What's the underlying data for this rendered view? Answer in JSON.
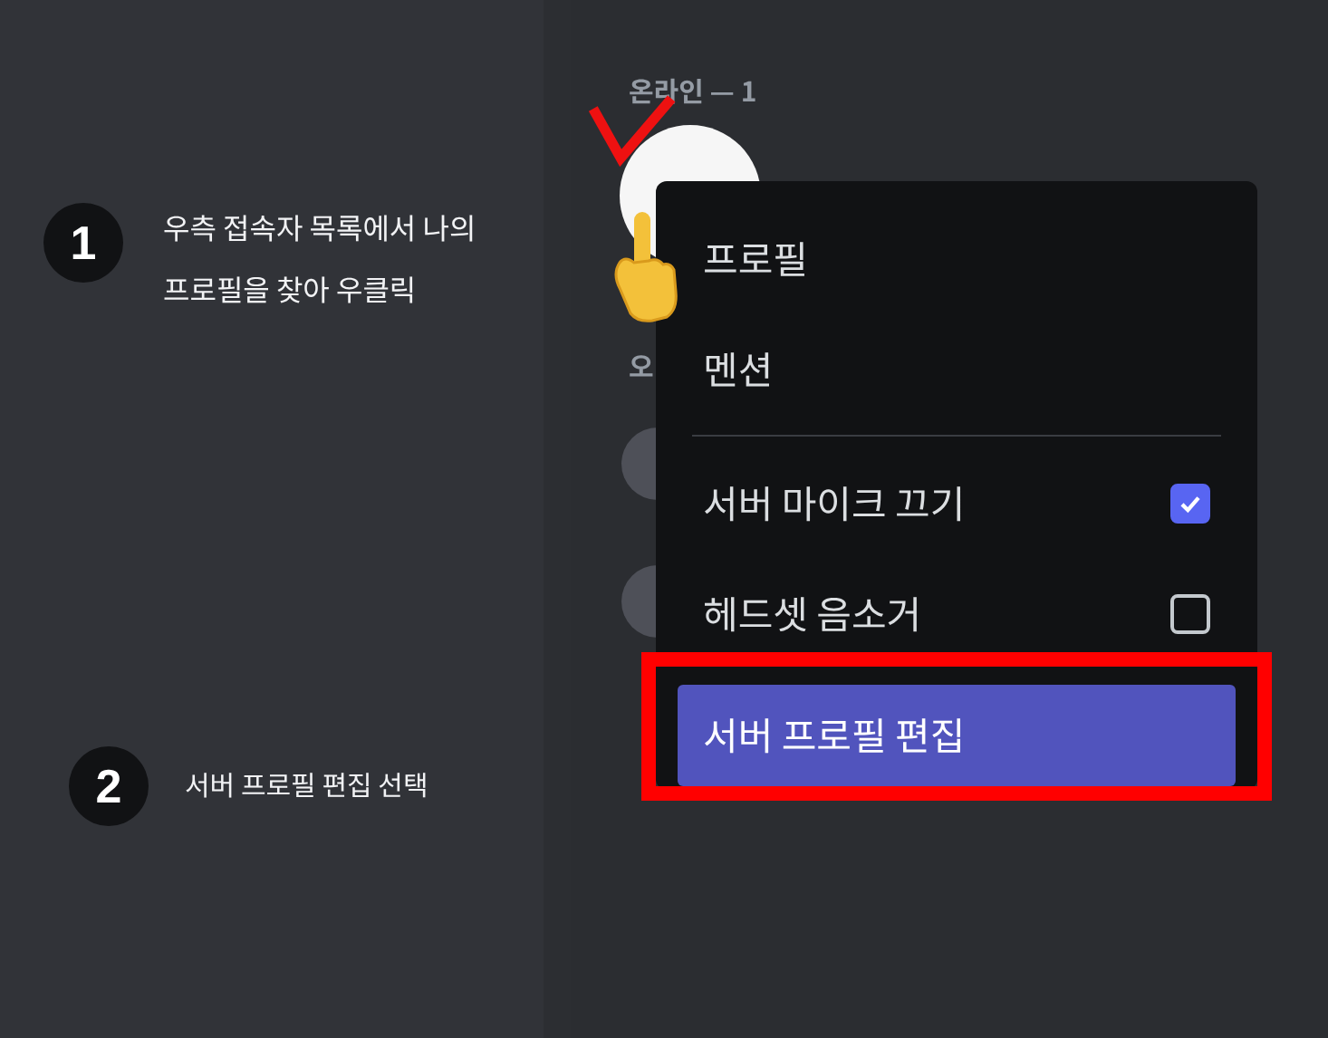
{
  "steps": [
    {
      "number": "1",
      "text": "우측 접속자 목록에서 나의\n프로필을 찾아 우클릭"
    },
    {
      "number": "2",
      "text": "서버 프로필 편집 선택"
    }
  ],
  "member_list": {
    "online_header": "온라인 — 1",
    "offline_header": "오"
  },
  "context_menu": {
    "items": [
      {
        "kind": "item",
        "label": "프로필",
        "selected": false
      },
      {
        "kind": "item",
        "label": "멘션",
        "selected": false
      },
      {
        "kind": "divider"
      },
      {
        "kind": "checkbox",
        "label": "서버 마이크 끄기",
        "checked": true,
        "selected": false
      },
      {
        "kind": "checkbox",
        "label": "헤드셋 음소거",
        "checked": false,
        "selected": false
      },
      {
        "kind": "item",
        "label": "서버 프로필 편집",
        "selected": true
      }
    ]
  }
}
